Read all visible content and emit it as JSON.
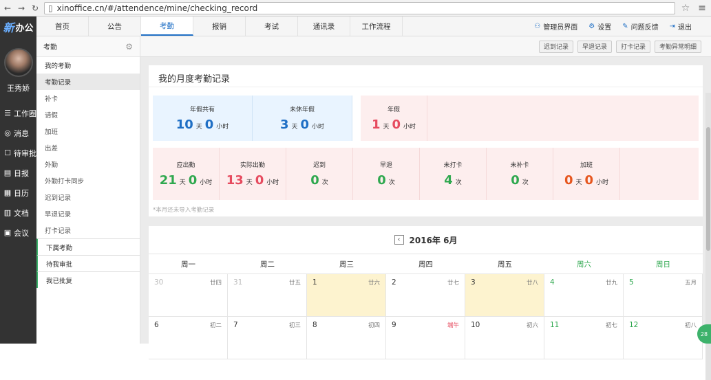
{
  "browser": {
    "url": "xinoffice.cn/#/attendence/mine/checking_record"
  },
  "brand": {
    "logo_mark": "新",
    "logo_text": "办公"
  },
  "user": {
    "name": "王秀娇"
  },
  "left_nav": [
    {
      "icon": "☰",
      "label": "工作圈"
    },
    {
      "icon": "◎",
      "label": "消息"
    },
    {
      "icon": "☐",
      "label": "待审批"
    },
    {
      "icon": "▤",
      "label": "日报"
    },
    {
      "icon": "▦",
      "label": "日历"
    },
    {
      "icon": "▥",
      "label": "文档"
    },
    {
      "icon": "▣",
      "label": "会议"
    }
  ],
  "top_tabs": [
    "首页",
    "公告",
    "考勤",
    "报销",
    "考试",
    "通讯录",
    "工作流程"
  ],
  "top_right": [
    {
      "icon": "⚇",
      "label": "管理员界面"
    },
    {
      "icon": "⚙",
      "label": "设置"
    },
    {
      "icon": "✎",
      "label": "问题反馈"
    },
    {
      "icon": "⇥",
      "label": "退出"
    }
  ],
  "sidebar": {
    "title": "考勤",
    "items": [
      "我的考勤",
      "考勤记录",
      "补卡",
      "请假",
      "加班",
      "出差",
      "外勤",
      "外勤打卡同步",
      "迟到记录",
      "早退记录",
      "打卡记录"
    ],
    "group_items": [
      "下属考勤",
      "待我审批",
      "我已批复"
    ]
  },
  "toolbar": [
    "迟到记录",
    "早退记录",
    "打卡记录",
    "考勤异常明细"
  ],
  "card": {
    "title": "我的月度考勤记录",
    "leave": [
      {
        "label": "年假共有",
        "a": "10",
        "au": "天",
        "b": "0",
        "bu": "小时"
      },
      {
        "label": "未休年假",
        "a": "3",
        "au": "天",
        "b": "0",
        "bu": "小时"
      }
    ],
    "annual": {
      "label": "年假",
      "a": "1",
      "au": "天",
      "b": "0",
      "bu": "小时"
    },
    "stats": [
      {
        "label": "应出勤",
        "a": "21",
        "au": "天",
        "b": "0",
        "bu": "小时"
      },
      {
        "label": "实际出勤",
        "a": "13",
        "au": "天",
        "b": "0",
        "bu": "小时"
      },
      {
        "label": "迟到",
        "a": "0",
        "au": "次"
      },
      {
        "label": "早退",
        "a": "0",
        "au": "次"
      },
      {
        "label": "未打卡",
        "a": "4",
        "au": "次"
      },
      {
        "label": "未补卡",
        "a": "0",
        "au": "次"
      },
      {
        "label": "加班",
        "a": "0",
        "au": "天",
        "b": "0",
        "bu": "小时"
      }
    ],
    "note": "*本月还未导入考勤记录"
  },
  "calendar": {
    "prev_icon": "‹",
    "month": "2016年 6月",
    "weekdays": [
      "周一",
      "周二",
      "周三",
      "周四",
      "周五",
      "周六",
      "周日"
    ],
    "days": [
      {
        "d": "30",
        "l": "廿四"
      },
      {
        "d": "31",
        "l": "廿五"
      },
      {
        "d": "1",
        "l": "廿六"
      },
      {
        "d": "2",
        "l": "廿七"
      },
      {
        "d": "3",
        "l": "廿八"
      },
      {
        "d": "4",
        "l": "廿九"
      },
      {
        "d": "5",
        "l": "五月"
      },
      {
        "d": "6",
        "l": "初二"
      },
      {
        "d": "7",
        "l": "初三"
      },
      {
        "d": "8",
        "l": "初四"
      },
      {
        "d": "9",
        "l": "端午"
      },
      {
        "d": "10",
        "l": "初六"
      },
      {
        "d": "11",
        "l": "初七"
      },
      {
        "d": "12",
        "l": "初八"
      }
    ]
  },
  "badge": "28"
}
